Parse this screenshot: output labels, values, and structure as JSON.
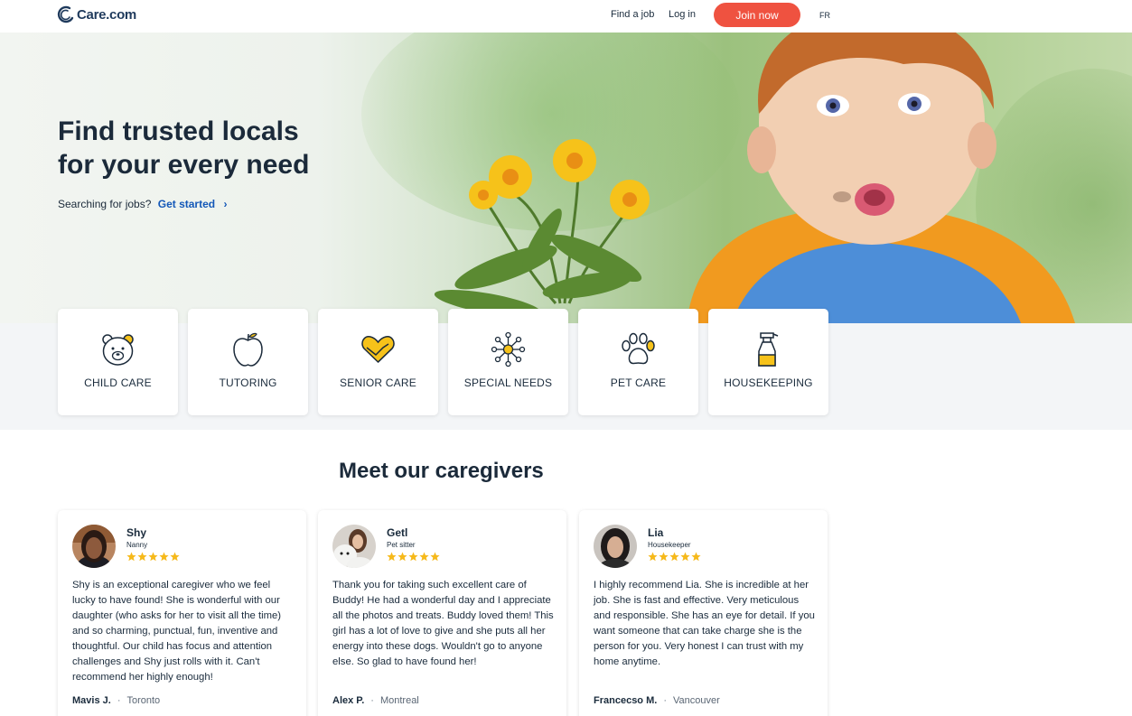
{
  "header": {
    "logo_text": "Care.com",
    "nav_find_job": "Find a job",
    "nav_login": "Log in",
    "join_label": "Join now",
    "lang": "FR",
    "accent_color": "#ef5240"
  },
  "hero": {
    "title_line1": "Find trusted locals",
    "title_line2": "for your every need",
    "sub_text": "Searching for jobs?",
    "sub_link": "Get started",
    "link_color": "#1458b8"
  },
  "categories": [
    {
      "label": "CHILD CARE",
      "icon": "bear-icon"
    },
    {
      "label": "TUTORING",
      "icon": "apple-icon"
    },
    {
      "label": "SENIOR CARE",
      "icon": "heart-hands-icon"
    },
    {
      "label": "SPECIAL NEEDS",
      "icon": "network-icon"
    },
    {
      "label": "PET CARE",
      "icon": "paw-icon"
    },
    {
      "label": "HOUSEKEEPING",
      "icon": "spray-bottle-icon"
    }
  ],
  "caregivers_section": {
    "title": "Meet our caregivers"
  },
  "reviews": [
    {
      "name": "Shy",
      "role": "Nanny",
      "rating": 5,
      "text": "Shy is an exceptional caregiver who we feel lucky to have found! She is wonderful with our daughter (who asks for her to visit all the time) and so charming, punctual, fun, inventive and thoughtful. Our child has focus and attention challenges and Shy just rolls with it. Can't recommend her highly enough!",
      "author": "Mavis J.",
      "city": "Toronto"
    },
    {
      "name": "Getl",
      "role": "Pet sitter",
      "rating": 5,
      "text": "Thank you for taking such excellent care of Buddy! He had a wonderful day and I appreciate all the photos and treats. Buddy loved them! This girl has a lot of love to give and she puts all her energy into these dogs. Wouldn't go to anyone else. So glad to have found her!",
      "author": "Alex P.",
      "city": "Montreal"
    },
    {
      "name": "Lia",
      "role": "Housekeeper",
      "rating": 5,
      "text": "I highly recommend Lia. She is incredible at her job. She is fast and effective. Very meticulous and responsible. She has an eye for detail. If you want someone that can take charge she is the person for you. Very honest I can trust with my home anytime.",
      "author": "Francecso M.",
      "city": "Vancouver"
    }
  ]
}
